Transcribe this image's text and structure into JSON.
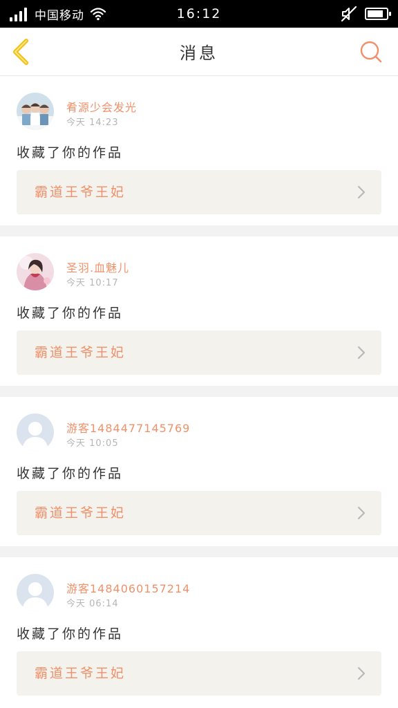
{
  "status_bar": {
    "carrier": "中国移动",
    "time": "16:12",
    "battery_level": 0.85,
    "signal_icon": "signal-icon",
    "wifi_icon": "wifi-icon",
    "mute_icon": "mute-icon"
  },
  "header": {
    "title": "消息",
    "back_icon": "chevron-left-icon",
    "search_icon": "search-icon"
  },
  "colors": {
    "accent": "#f0906a",
    "back_arrow": "#f2c012",
    "card_link_bg": "#f3f2ec",
    "separator": "#f2f2f2"
  },
  "messages": [
    {
      "username": "肴源少会发光",
      "time": "今天 14:23",
      "action": "收藏了你的作品",
      "work_title": "霸道王爷王妃",
      "avatar": "photo"
    },
    {
      "username": "圣羽.血魅儿",
      "time": "今天 10:17",
      "action": "收藏了你的作品",
      "work_title": "霸道王爷王妃",
      "avatar": "photo"
    },
    {
      "username": "游客1484477145769",
      "time": "今天 10:05",
      "action": "收藏了你的作品",
      "work_title": "霸道王爷王妃",
      "avatar": "default"
    },
    {
      "username": "游客1484060157214",
      "time": "今天 06:14",
      "action": "收藏了你的作品",
      "work_title": "霸道王爷王妃",
      "avatar": "default"
    }
  ]
}
